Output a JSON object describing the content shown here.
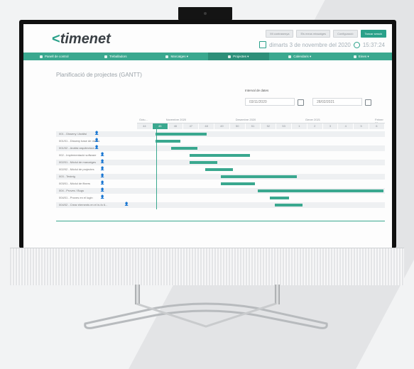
{
  "app": {
    "logo_text": "timenet",
    "logo_mark": "<"
  },
  "header": {
    "buttons": [
      {
        "label": "Mi contrasenya",
        "primary": false
      },
      {
        "label": "Els meus missatges",
        "primary": false
      },
      {
        "label": "Configuració",
        "primary": false
      },
      {
        "label": "Tancar sessió",
        "primary": true
      }
    ],
    "date": "dimarts 3 de novembre del 2020",
    "time": "15:37:24"
  },
  "nav": [
    {
      "label": "Panell de control",
      "active": false
    },
    {
      "label": "Treballadors",
      "active": false
    },
    {
      "label": "Marcatges ▾",
      "active": false
    },
    {
      "label": "Projectes ▾",
      "active": true
    },
    {
      "label": "Calendaris ▾",
      "active": false
    },
    {
      "label": "Eines ▾",
      "active": false
    }
  ],
  "page": {
    "title": "Planificació de projectes (GANTT)"
  },
  "filter": {
    "label": "Interval de dates",
    "from": "03/11/2020",
    "to": "28/02/2021"
  },
  "gantt": {
    "periods": [
      {
        "label": "Octu..."
      },
      {
        "label": "Novembre 2020"
      },
      {
        "label": "Desembre 2020"
      },
      {
        "label": "Gener 2021"
      },
      {
        "label": "Febrer 20"
      }
    ],
    "weeks": [
      "44",
      "45",
      "46",
      "47",
      "48",
      "49",
      "50",
      "51",
      "52",
      "53",
      "1",
      "2",
      "3",
      "4",
      "5",
      "6"
    ],
    "tasks": [
      {
        "name": "001 - Disseny i Anàlisi",
        "start": 1.2,
        "end": 4.5
      },
      {
        "name": "001/01 - Disseny base de dades",
        "start": 1.2,
        "end": 2.8
      },
      {
        "name": "001/02 - Anàlisi arquitectura",
        "start": 2.2,
        "end": 3.9
      },
      {
        "name": "002 - Implementació software",
        "start": 3.4,
        "end": 7.3
      },
      {
        "name": "002/01 - Mòdul de marcatges",
        "start": 3.4,
        "end": 5.2
      },
      {
        "name": "002/02 - Mòdul de projectes",
        "start": 4.4,
        "end": 6.2
      },
      {
        "name": "003 - Testeig",
        "start": 5.4,
        "end": 10.3
      },
      {
        "name": "003/01 - Mòdul de fitxers",
        "start": 5.4,
        "end": 7.6
      },
      {
        "name": "004 - Proves / Bugs",
        "start": 7.8,
        "end": 15.9
      },
      {
        "name": "004/01 - Proves en el login",
        "start": 8.6,
        "end": 9.8
      },
      {
        "name": "004/02 - Crear elements en el in-fo 6...",
        "start": 8.9,
        "end": 10.7
      }
    ]
  },
  "colors": {
    "accent": "#3aa88f",
    "accent_dark": "#2d8f79"
  }
}
